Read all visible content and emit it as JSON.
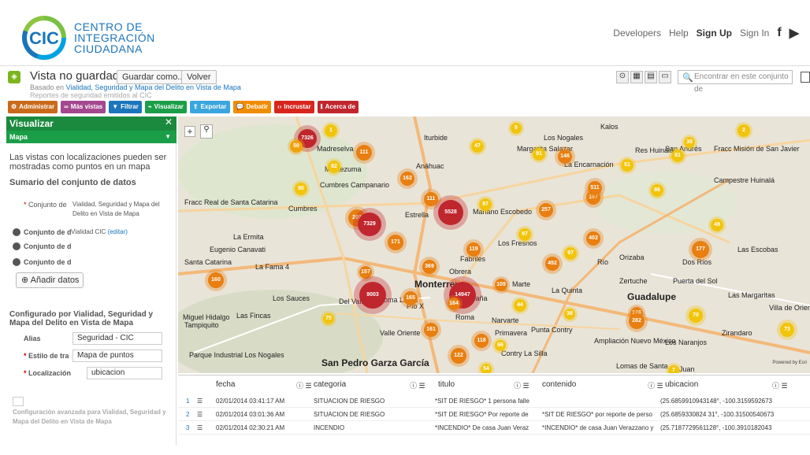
{
  "header": {
    "logo_abbr": "CIC",
    "logo_lines": [
      "CENTRO DE",
      "INTEGRACIÓN",
      "CIUDADANA"
    ],
    "links": [
      "Developers",
      "Help",
      "Sign Up",
      "Sign In"
    ],
    "facebook": "f",
    "twitter": "🐦"
  },
  "view": {
    "title": "Vista no guardada",
    "save_label": "Guardar como...",
    "back_label": "Volver",
    "based_prefix": "Basado en",
    "based_link": "Vialidad, Seguridad y Mapa del Delito en Vista de Mapa",
    "reports": "Reportes de seguridad emitidos al CIC",
    "search_placeholder": "Encontrar en este conjunto de"
  },
  "toolbar": [
    {
      "label": "Administrar",
      "color": "#c96a1b"
    },
    {
      "label": "Más vistas",
      "color": "#a4478f"
    },
    {
      "label": "Filtrar",
      "color": "#1b75bc"
    },
    {
      "label": "Visualizar",
      "color": "#1b9e48"
    },
    {
      "label": "Exportar",
      "color": "#3aa6dd"
    },
    {
      "label": "Debatir",
      "color": "#f08c00"
    },
    {
      "label": "Incrustar",
      "color": "#d7261e"
    },
    {
      "label": "Acerca de",
      "color": "#c0262d"
    }
  ],
  "sidebar": {
    "header": "Visualizar",
    "subheader": "Mapa",
    "intro": "Las vistas con localizaciones pueden ser mostradas como puntos en un mapa",
    "summary_title": "Sumario del conjunto de datos",
    "dataset_label": "Conjunto de",
    "dataset_value_1": "Vialidad, Seguridad y Mapa del",
    "dataset_value_2": "Delito en Vista de Mapa",
    "row2_label": "Conjunto de d",
    "row2_value": "Vialidad CIC",
    "row2_edit": "(editar)",
    "row3_label": "Conjunto de d",
    "row4_label": "Conjunto de d",
    "add_data": "Añadir datos",
    "configured_by": "Configurado por Vialidad, Seguridad y Mapa del Delito en Vista de Mapa",
    "alias_label": "Alias",
    "alias_value": "Seguridad - CIC",
    "style_label": "Estilo de tra",
    "style_value": "Mapa de puntos",
    "location_label": "Localización",
    "location_value": "ubicacion",
    "advanced": "Configuración avanzada para Vialidad, Seguridad y Mapa del Delito en Vista de Mapa"
  },
  "map": {
    "labels": [
      "Iturbide",
      "Madreselva",
      "Moctezuma",
      "Anáhuac",
      "Cumbres Campanario",
      "Cumbres",
      "Estrella",
      "Mariano Escobedo",
      "Los Nogales",
      "Margarita Salazar",
      "La Encarnación",
      "Res Huinalá",
      "San Andrés",
      "Fracc Misión de San Javier",
      "Campestre Huinalá",
      "Fracc Real de Santa Catarina",
      "La Ermita",
      "Eugenio Canavati",
      "La Fama 4",
      "Los Fresnos",
      "Fabriles",
      "Obrera",
      "Río",
      "Orizaba",
      "Dos Ríos",
      "Las Escobas",
      "Monterrey",
      "España",
      "Marte",
      "La Quinta",
      "Zertuche",
      "Puerta del Sol",
      "Guadalupe",
      "Las Margaritas",
      "Villa de Oriente",
      "Los Sauces",
      "Del Valle",
      "Loma Larga",
      "Pío X",
      "Miguel Hidalgo",
      "Las Fincas",
      "Tampiquito",
      "Valle Oriente",
      "Roma",
      "Narvarte",
      "Primavera",
      "Punta Contry",
      "Ampliación Nuevo México",
      "Los Naranjos",
      "Zirandaro",
      "Parque Industrial Los Nogales",
      "San Pedro Garza García",
      "Contry La Silla",
      "Lomas de Santa",
      "Juan",
      "Santa Catarina",
      "Kalos"
    ],
    "credit": "Powered by Esri",
    "clusters": [
      {
        "v": "7326",
        "c": "#c0262d"
      },
      {
        "v": "1",
        "c": "#f2c40c"
      },
      {
        "v": "50",
        "c": "#f0a20c"
      },
      {
        "v": "111",
        "c": "#e87f10"
      },
      {
        "v": "82",
        "c": "#f2c40c"
      },
      {
        "v": "162",
        "c": "#e87f10"
      },
      {
        "v": "90",
        "c": "#f2c40c"
      },
      {
        "v": "111",
        "c": "#e87f10"
      },
      {
        "v": "5",
        "c": "#f2c40c"
      },
      {
        "v": "47",
        "c": "#f2c40c"
      },
      {
        "v": "91",
        "c": "#f2c40c"
      },
      {
        "v": "146",
        "c": "#e87f10"
      },
      {
        "v": "51",
        "c": "#f2c40c"
      },
      {
        "v": "30",
        "c": "#f2c40c"
      },
      {
        "v": "81",
        "c": "#f2c40c"
      },
      {
        "v": "2",
        "c": "#f2c40c"
      },
      {
        "v": "203",
        "c": "#e87f10"
      },
      {
        "v": "7329",
        "c": "#c0262d"
      },
      {
        "v": "5528",
        "c": "#c0262d"
      },
      {
        "v": "97",
        "c": "#f2c40c"
      },
      {
        "v": "257",
        "c": "#e87f10"
      },
      {
        "v": "107",
        "c": "#e87f10"
      },
      {
        "v": "511",
        "c": "#e87f10"
      },
      {
        "v": "86",
        "c": "#f2c40c"
      },
      {
        "v": "171",
        "c": "#e87f10"
      },
      {
        "v": "97",
        "c": "#f2c40c"
      },
      {
        "v": "119",
        "c": "#e87f10"
      },
      {
        "v": "402",
        "c": "#e87f10"
      },
      {
        "v": "97",
        "c": "#f2c40c"
      },
      {
        "v": "492",
        "c": "#e87f10"
      },
      {
        "v": "177",
        "c": "#e87f10"
      },
      {
        "v": "49",
        "c": "#f2c40c"
      },
      {
        "v": "369",
        "c": "#e87f10"
      },
      {
        "v": "157",
        "c": "#e87f10"
      },
      {
        "v": "160",
        "c": "#e87f10"
      },
      {
        "v": "9003",
        "c": "#c0262d"
      },
      {
        "v": "14947",
        "c": "#c0262d"
      },
      {
        "v": "109",
        "c": "#e87f10"
      },
      {
        "v": "165",
        "c": "#e87f10"
      },
      {
        "v": "164",
        "c": "#e87f10"
      },
      {
        "v": "44",
        "c": "#f2c40c"
      },
      {
        "v": "38",
        "c": "#f2c40c"
      },
      {
        "v": "126",
        "c": "#e87f10"
      },
      {
        "v": "282",
        "c": "#e87f10"
      },
      {
        "v": "70",
        "c": "#f2c40c"
      },
      {
        "v": "75",
        "c": "#f2c40c"
      },
      {
        "v": "161",
        "c": "#e87f10"
      },
      {
        "v": "118",
        "c": "#e87f10"
      },
      {
        "v": "66",
        "c": "#f2c40c"
      },
      {
        "v": "73",
        "c": "#f2c40c"
      },
      {
        "v": "122",
        "c": "#e87f10"
      },
      {
        "v": "54",
        "c": "#f2c40c"
      },
      {
        "v": "7",
        "c": "#f2c40c"
      }
    ]
  },
  "table": {
    "headers": [
      "fecha",
      "categoria",
      "titulo",
      "contenido",
      "ubicacion"
    ],
    "rows": [
      {
        "n": "1",
        "fecha": "02/01/2014 03:41:17 AM",
        "categoria": "SITUACION DE RIESGO",
        "titulo": "*SIT DE RIESGO* 1 persona falle",
        "contenido": "",
        "ubicacion": "(25.6859910943148°, -100.3159592673"
      },
      {
        "n": "2",
        "fecha": "02/01/2014 03:01:36 AM",
        "categoria": "SITUACION DE RIESGO",
        "titulo": "*SIT DE RIESGO* Por reporte de",
        "contenido": "*SIT DE RIESGO* por reporte de perso",
        "ubicacion": "(25.6859330824 31°, -100.31500540673"
      },
      {
        "n": "3",
        "fecha": "02/01/2014 02:30:21 AM",
        "categoria": "INCENDIO",
        "titulo": "*INCENDIO* De casa Juan Veraz",
        "contenido": "*INCENDIO* de casa Juan Verazzano y",
        "ubicacion": "(25.7187729561128°, -100.3910182043"
      }
    ]
  }
}
